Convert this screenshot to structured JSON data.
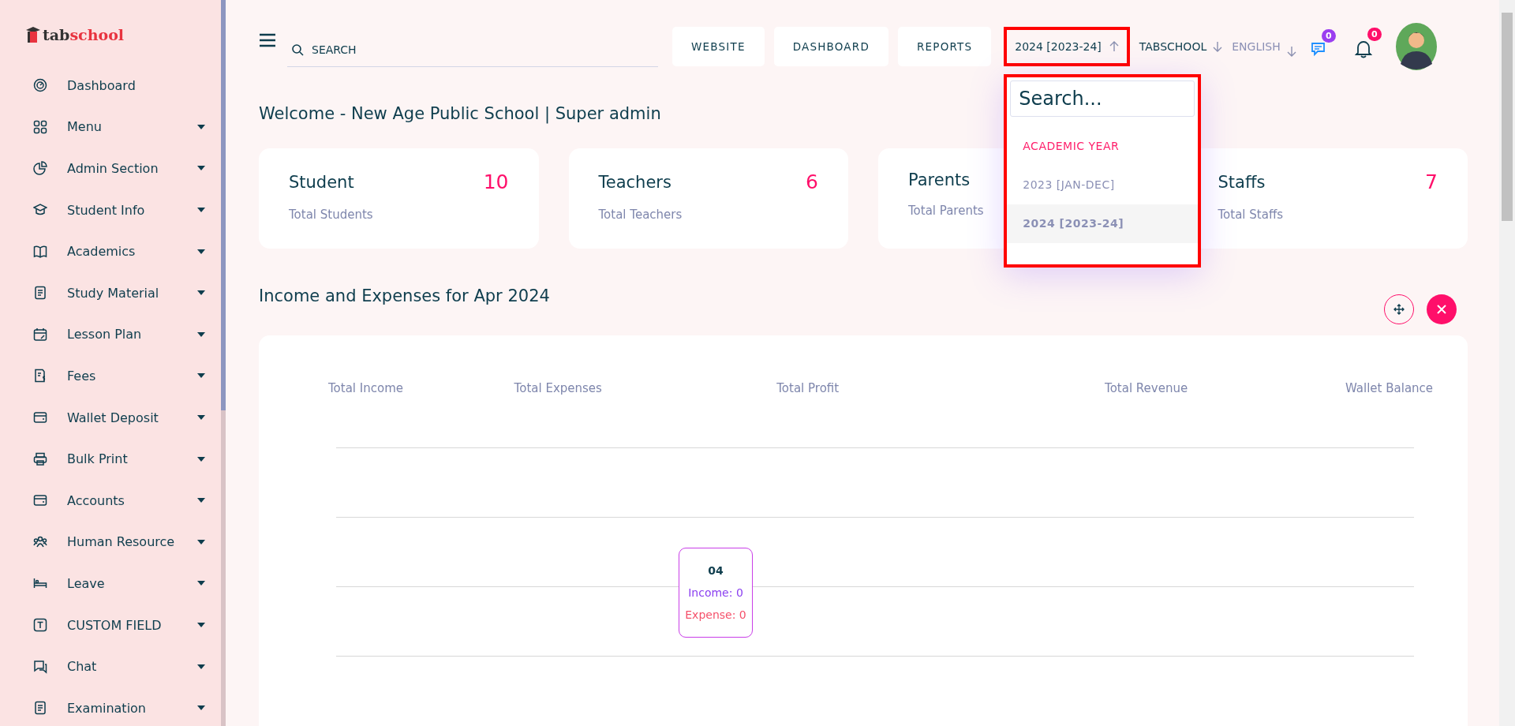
{
  "sidebar": {
    "logo": {
      "part_1": "tab",
      "part_2": "school"
    },
    "items": [
      {
        "label": "Dashboard",
        "has_submenu": false
      },
      {
        "label": "Menu",
        "has_submenu": true
      },
      {
        "label": "Admin Section",
        "has_submenu": true
      },
      {
        "label": "Student Info",
        "has_submenu": true
      },
      {
        "label": "Academics",
        "has_submenu": true
      },
      {
        "label": "Study Material",
        "has_submenu": true
      },
      {
        "label": "Lesson Plan",
        "has_submenu": true
      },
      {
        "label": "Fees",
        "has_submenu": true
      },
      {
        "label": "Wallet Deposit",
        "has_submenu": true
      },
      {
        "label": "Bulk Print",
        "has_submenu": true
      },
      {
        "label": "Accounts",
        "has_submenu": true
      },
      {
        "label": "Human Resource",
        "has_submenu": true
      },
      {
        "label": "Leave",
        "has_submenu": true
      },
      {
        "label": "CUSTOM FIELD",
        "has_submenu": true
      },
      {
        "label": "Chat",
        "has_submenu": true
      },
      {
        "label": "Examination",
        "has_submenu": true
      }
    ]
  },
  "topbar": {
    "search": {
      "placeholder": "SEARCH"
    },
    "buttons": [
      "WEBSITE",
      "DASHBOARD",
      "REPORTS"
    ],
    "year_selector": {
      "value": "2024 [2023-24]",
      "expanded": true,
      "highlighted": true
    },
    "school_selector": "TABSCHOOL",
    "language_selector": "ENGLISH",
    "messages_badge": "0",
    "notifications_badge": "0"
  },
  "year_dropdown": {
    "highlighted": true,
    "search": {
      "placeholder": "Search..."
    },
    "items": [
      {
        "kind": "header",
        "label": "ACADEMIC YEAR"
      },
      {
        "kind": "option",
        "label": "2023 [JAN-DEC]",
        "selected": false
      },
      {
        "kind": "option",
        "label": "2024 [2023-24]",
        "selected": true
      }
    ]
  },
  "welcome": "Welcome - New Age Public School | Super admin",
  "stat_cards": [
    {
      "title": "Student",
      "count": "10",
      "subtitle": "Total Students"
    },
    {
      "title": "Teachers",
      "count": "6",
      "subtitle": "Total Teachers"
    },
    {
      "title": "Parents",
      "subtitle": "Total Parents"
    },
    {
      "title": "Staffs",
      "count": "7",
      "subtitle": "Total Staffs"
    }
  ],
  "income_section": {
    "title": "Income and Expenses for Apr 2024",
    "summary_labels": [
      "Total Income",
      "Total Expenses",
      "Total Profit",
      "Total Revenue",
      "Wallet Balance"
    ],
    "tooltip": {
      "title": "04",
      "income": "Income: 0",
      "expense": "Expense: 0"
    }
  }
}
